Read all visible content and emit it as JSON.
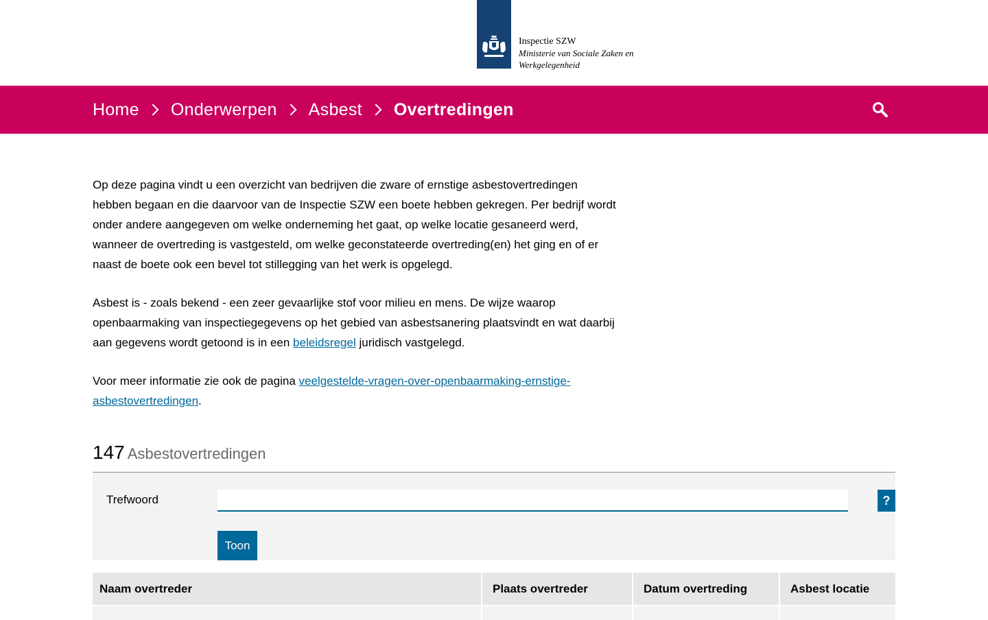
{
  "header": {
    "org_name": "Inspectie SZW",
    "ministry": "Ministerie van Sociale Zaken en Werkgelegenheid"
  },
  "breadcrumb": [
    {
      "label": "Home"
    },
    {
      "label": "Onderwerpen"
    },
    {
      "label": "Asbest"
    },
    {
      "label": "Overtredingen"
    }
  ],
  "intro": {
    "p1": "Op deze pagina vindt u een overzicht van bedrijven die zware of ernstige asbestovertredingen hebben begaan en die daarvoor van de Inspectie SZW een boete hebben gekregen. Per bedrijf wordt onder andere aangegeven om welke onderneming het gaat, op welke locatie gesaneerd werd, wanneer de overtreding is vastgesteld, om welke geconstateerde overtreding(en) het ging en of er naast de boete ook een bevel tot stillegging van het werk is opgelegd.",
    "p2_before": "Asbest is - zoals bekend - een zeer gevaarlijke stof voor milieu en mens. De wijze waarop openbaarmaking van inspectiegegevens op het gebied van asbestsanering plaatsvindt en wat daarbij aan gegevens wordt getoond is in een ",
    "p2_link": "beleidsregel",
    "p2_after": " juridisch vastgelegd.",
    "p3_before": "Voor meer informatie zie ook de pagina ",
    "p3_link": "veelgestelde-vragen-over-openbaarmaking-ernstige-asbestovertredingen",
    "p3_after": "."
  },
  "results": {
    "count": "147",
    "label": "Asbestovertredingen"
  },
  "filter": {
    "label": "Trefwoord",
    "value": "",
    "help": "?",
    "submit": "Toon"
  },
  "table": {
    "headers": [
      "Naam overtreder",
      "Plaats overtreder",
      "Datum overtreding",
      "Asbest locatie"
    ]
  },
  "colors": {
    "nav": "#ca005d",
    "logo": "#154273",
    "link": "#01689b"
  },
  "icons": {
    "search": "search-icon",
    "chevron": "chevron-right-icon",
    "emblem": "rijkslint-emblem-icon"
  }
}
